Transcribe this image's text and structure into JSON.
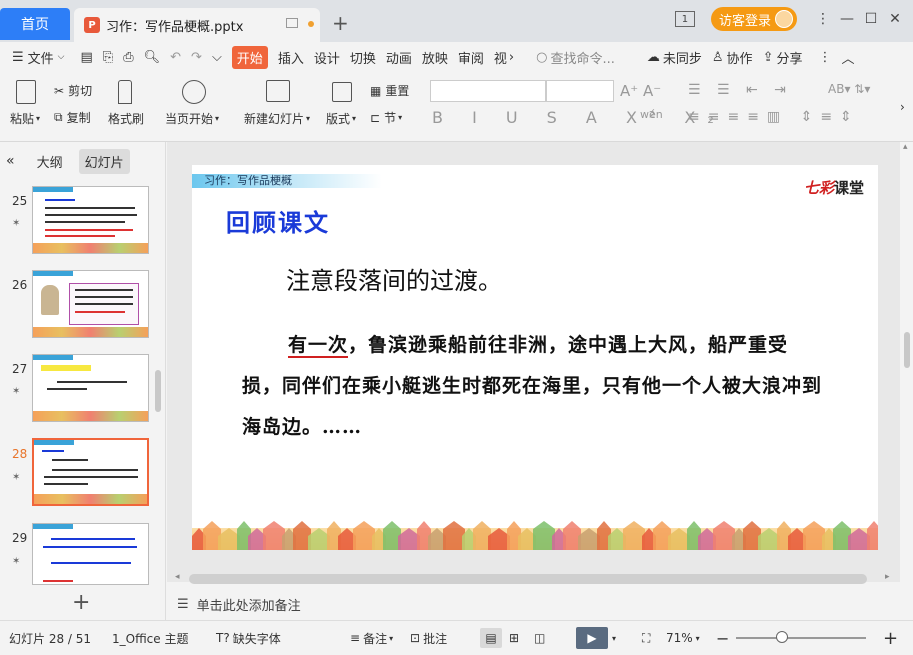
{
  "titlebar": {
    "home_tab": "首页",
    "doc_tab": "习作：写作品梗概.pptx",
    "guest_login": "访客登录",
    "badge": "1"
  },
  "menu": {
    "file": "文件",
    "items": [
      "开始",
      "插入",
      "设计",
      "切换",
      "动画",
      "放映",
      "审阅",
      "视"
    ],
    "active": "开始",
    "search_placeholder": "查找命令...",
    "unsync": "未同步",
    "collab": "协作",
    "share": "分享"
  },
  "ribbon": {
    "paste": "粘贴",
    "cut": "剪切",
    "copy": "复制",
    "format_painter": "格式刷",
    "from_current": "当页开始",
    "new_slide": "新建幻灯片",
    "layout": "版式",
    "reset": "重置",
    "section": "节"
  },
  "left_pane": {
    "outline_tab": "大纲",
    "slides_tab": "幻灯片",
    "active_tab": "幻灯片",
    "slide_numbers": [
      "25",
      "26",
      "27",
      "28",
      "29"
    ],
    "selected": "28"
  },
  "slide": {
    "header_text": "习作：写作品梗概",
    "logo_text": "七彩",
    "logo_suffix": "课堂",
    "heading": "回顾课文",
    "subline": "注意段落间的过渡。",
    "para_lead": "有一次",
    "para_rest": "，鲁滨逊乘船前往非洲，途中遇上大风，船严重受损，同伴们在乘小艇逃生时都死在海里，只有他一个人被大浪冲到海岛边。……"
  },
  "notes_placeholder": "单击此处添加备注",
  "status": {
    "slide_counter": "幻灯片 28 / 51",
    "theme": "1_Office 主题",
    "missing_font": "缺失字体",
    "notes": "备注",
    "comments": "批注",
    "zoom": "71%"
  },
  "colors": {
    "accent": "#f0653b",
    "home_tab": "#2d7ef7",
    "guest_btn": "#f59a14",
    "heading_blue": "#1a3ad8"
  }
}
